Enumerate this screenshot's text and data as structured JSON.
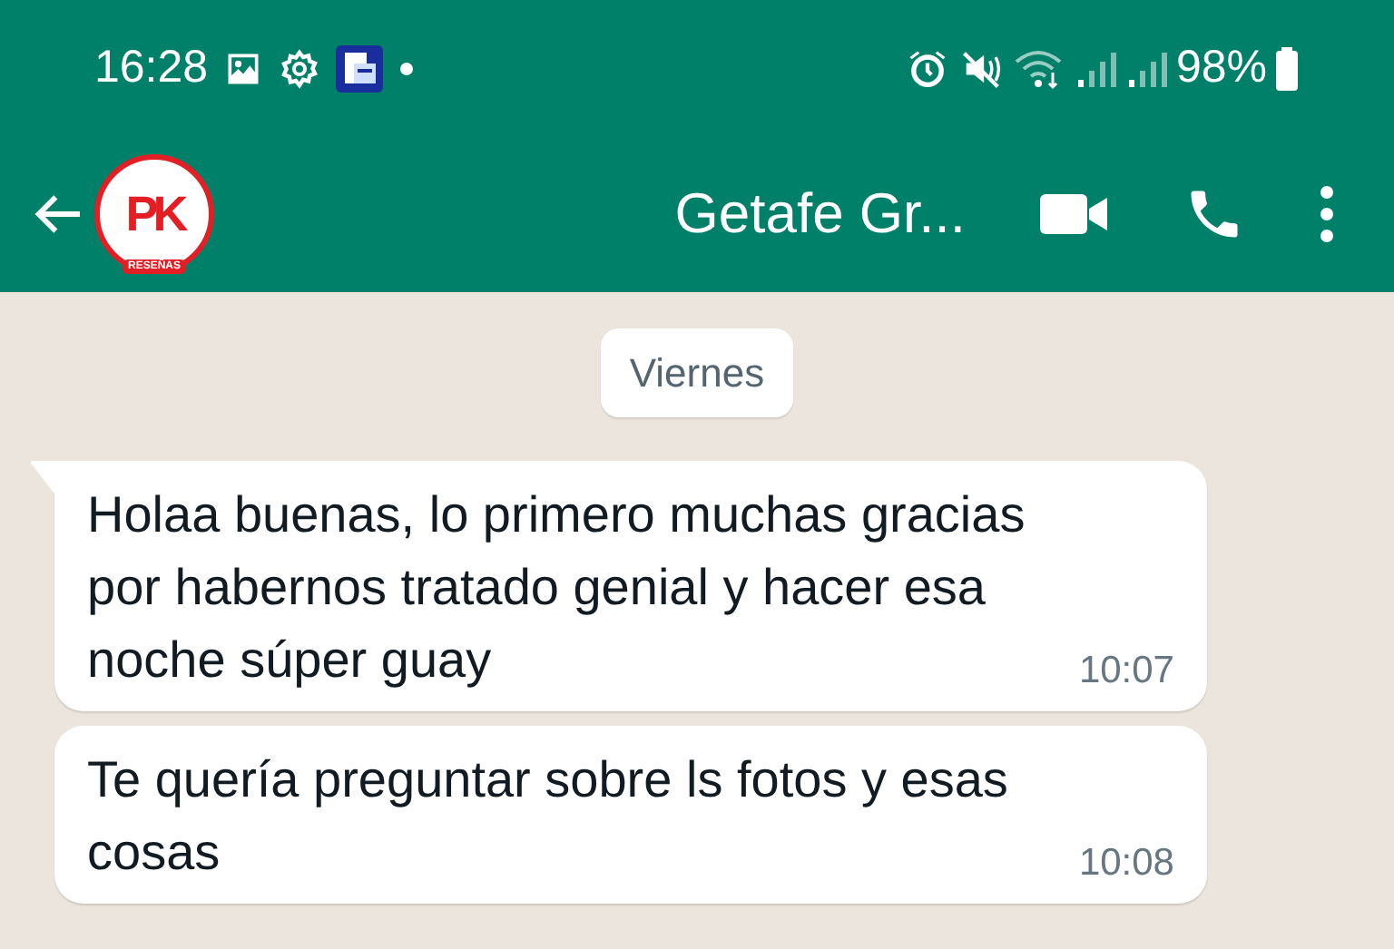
{
  "status_bar": {
    "time": "16:28",
    "battery": "98%"
  },
  "header": {
    "avatar": {
      "logo_text": "PK",
      "logo_caption": "RESEÑAS"
    },
    "title": "Getafe Gr..."
  },
  "date_chip": "Viernes",
  "messages": [
    {
      "text": "Holaa buenas, lo primero muchas gracias por habernos tratado genial y hacer esa noche súper guay",
      "time": "10:07",
      "tail": true
    },
    {
      "text": "Te quería preguntar sobre ls fotos y esas cosas",
      "time": "10:08",
      "tail": false
    }
  ]
}
